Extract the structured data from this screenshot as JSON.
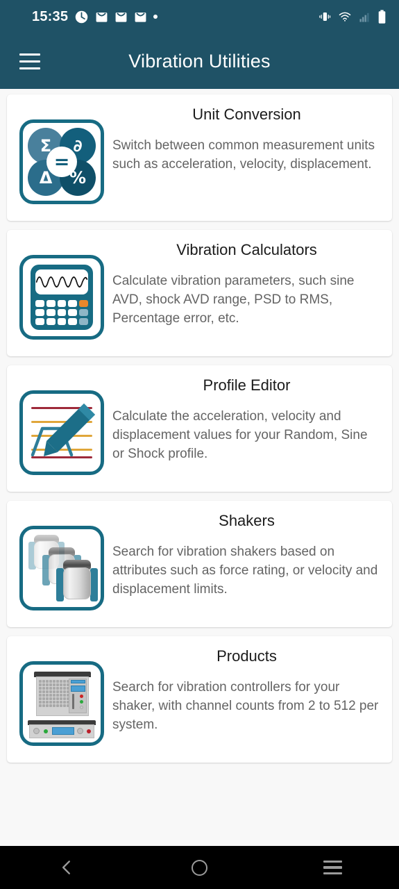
{
  "theme": {
    "brand_teal": "#1f5266",
    "icon_outline": "#176b83",
    "accent_orange": "#e8872b",
    "card_bg": "#ffffff",
    "page_bg": "#f8f8f8",
    "title_color": "#1b1b1b",
    "desc_color": "#646464"
  },
  "status_bar": {
    "time": "15:35",
    "left_icons": [
      "clock-icon",
      "mail-icon",
      "mail-icon",
      "mail-icon",
      "dot-icon"
    ],
    "right_icons": [
      "vibrate-icon",
      "wifi-icon",
      "cellular-signal-icon",
      "battery-icon"
    ]
  },
  "app_bar": {
    "title": "Vibration Utilities",
    "menu_icon": "hamburger-menu-icon"
  },
  "cards": [
    {
      "id": "unit-conversion",
      "title": "Unit Conversion",
      "description": "Switch between common measurement units such as acceleration, velocity, displacement.",
      "icon": "unit-conversion-icon",
      "icon_glyphs": [
        "Σ",
        "∂",
        "Δ",
        "%",
        "="
      ]
    },
    {
      "id": "vibration-calculators",
      "title": "Vibration Calculators",
      "description": "Calculate vibration parameters, such sine AVD, shock AVD range, PSD to RMS, Percentage error, etc.",
      "icon": "calculator-icon"
    },
    {
      "id": "profile-editor",
      "title": "Profile Editor",
      "description": "Calculate the acceleration, velocity and displacement values for your Random, Sine or Shock profile.",
      "icon": "profile-editor-icon"
    },
    {
      "id": "shakers",
      "title": "Shakers",
      "description": "Search for vibration shakers based on attributes such as force rating, or velocity and displacement limits.",
      "icon": "shakers-icon"
    },
    {
      "id": "products",
      "title": "Products",
      "description": "Search for vibration controllers for your shaker, with channel counts from 2 to 512 per system.",
      "icon": "vibration-controller-icon"
    }
  ],
  "nav_bar": {
    "back_icon": "back-chevron-icon",
    "home_icon": "home-circle-icon",
    "recents_icon": "recents-icon"
  }
}
